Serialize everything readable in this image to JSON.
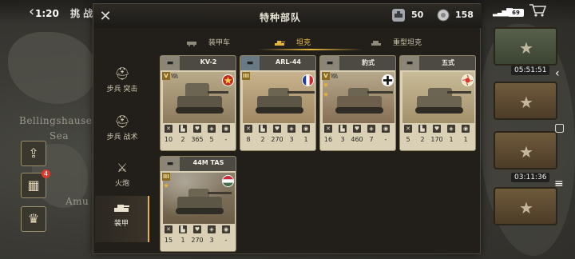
{
  "statusbar": {
    "time": "1:20",
    "title": "挑 战",
    "battery": "69"
  },
  "dialog": {
    "title": "特种部队",
    "resources": [
      {
        "icon": "tank-ticket-icon",
        "value": "50"
      },
      {
        "icon": "medal-icon",
        "value": "158"
      }
    ]
  },
  "tabs": [
    {
      "label": "装甲车",
      "icon": "armored-car-icon",
      "active": false
    },
    {
      "label": "坦克",
      "icon": "tank-icon",
      "active": true
    },
    {
      "label": "重型坦克",
      "icon": "heavy-tank-icon",
      "active": false
    }
  ],
  "sidebar": [
    {
      "label": "步兵 突击",
      "icon": "helmet-icon",
      "active": false
    },
    {
      "label": "步兵 战术",
      "icon": "helmet-icon",
      "active": false
    },
    {
      "label": "火炮",
      "icon": "artillery-icon",
      "active": false
    },
    {
      "label": "装甲",
      "icon": "tank-icon",
      "active": true
    }
  ],
  "cards": [
    {
      "name": "KV-2",
      "rank": "V",
      "stars": 0,
      "flag": "soviet-flag-icon",
      "stats": [
        "10",
        "2",
        "365",
        "5",
        "-"
      ]
    },
    {
      "name": "ARL-44",
      "rank": "III",
      "stars": 0,
      "flag": "france-flag-icon",
      "stats": [
        "8",
        "2",
        "270",
        "3",
        "1"
      ]
    },
    {
      "name": "豹式",
      "rank": "V",
      "stars": 2,
      "flag": "germany-cross-icon",
      "stats": [
        "16",
        "3",
        "460",
        "7",
        "-"
      ]
    },
    {
      "name": "五式",
      "rank": "",
      "stars": 0,
      "flag": "japan-flag-icon",
      "stats": [
        "5",
        "2",
        "170",
        "1",
        "1"
      ]
    },
    {
      "name": "44M TAS",
      "rank": "III",
      "stars": 1,
      "flag": "hungary-flag-icon",
      "stats": [
        "15",
        "1",
        "270",
        "3",
        "-"
      ]
    }
  ],
  "map": {
    "label1": "Bellingshausen",
    "label2": "Sea",
    "label3": "Amu"
  },
  "crates": [
    {
      "timer": "05:51:51"
    },
    {
      "timer": "03:11:36"
    }
  ],
  "left_buttons": [
    {
      "icon": "share-icon"
    },
    {
      "icon": "film-icon",
      "badge": "4"
    },
    {
      "icon": "trophy-icon"
    }
  ],
  "colors": {
    "accent": "#e7b53a",
    "card_bg": "#d9d0b6"
  }
}
